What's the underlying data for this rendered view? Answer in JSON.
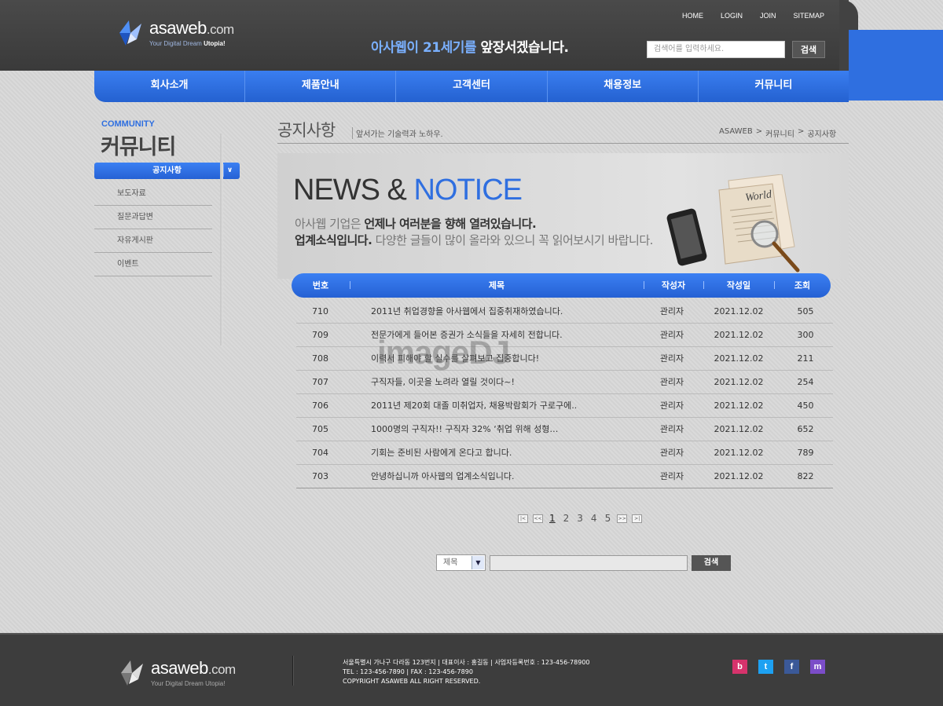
{
  "header": {
    "logo_name": "asaweb",
    "logo_com": ".com",
    "logo_sub_1": "Your Digital Dream",
    "logo_sub_2": "Utopia!",
    "util_links": [
      "HOME",
      "LOGIN",
      "JOIN",
      "SITEMAP"
    ],
    "slogan_hl": "아사웹이 21세기를",
    "slogan_rest": " 앞장서겠습니다.",
    "search_placeholder": "검색어를 입력하세요.",
    "search_button": "검색"
  },
  "nav": [
    "회사소개",
    "제품안내",
    "고객센터",
    "채용정보",
    "커뮤니티"
  ],
  "sidebar": {
    "title_en": "COMMUNITY",
    "title_ko": "커뮤니티",
    "active": "공지사항",
    "active_chevron": "∨",
    "items": [
      "보도자료",
      "질문과답변",
      "자유게시판",
      "이벤트"
    ]
  },
  "content": {
    "title": "공지사항",
    "subtitle": "앞서가는 기술력과 노하우.",
    "breadcrumb": [
      "ASAWEB",
      ">",
      "커뮤니티",
      ">",
      "공지사항"
    ],
    "banner_h_1": "NEWS & ",
    "banner_h_2": "NOTICE",
    "banner_l1_a": "아사웹 기업은 ",
    "banner_l1_b": "언제나 여러분을 향해 열려있습니다.",
    "banner_l2_a": "업계소식입니다.",
    "banner_l2_b": " 다양한 글들이 많이 올라와 있으니 꼭 읽어보시기 바랍니다.",
    "newspaper_word": "World"
  },
  "table": {
    "headers": [
      "번호",
      "제목",
      "작성자",
      "작성일",
      "조회"
    ],
    "rows": [
      {
        "no": "710",
        "title": "2011년 취업경향을 아사웹에서 집중취재하였습니다.",
        "author": "관리자",
        "date": "2021.12.02",
        "views": "505"
      },
      {
        "no": "709",
        "title": "전문가에게 들어본 증권가 소식들을 자세히 전합니다.",
        "author": "관리자",
        "date": "2021.12.02",
        "views": "300"
      },
      {
        "no": "708",
        "title": "이력서 피해야 할 실수를 살펴보고 집중합니다!",
        "author": "관리자",
        "date": "2021.12.02",
        "views": "211"
      },
      {
        "no": "707",
        "title": "구직자들, 이곳을 노려라 열릴 것이다~!",
        "author": "관리자",
        "date": "2021.12.02",
        "views": "254"
      },
      {
        "no": "706",
        "title": "2011년 제20회 대졸 미취업자, 채용박람회가 구로구에..",
        "author": "관리자",
        "date": "2021.12.02",
        "views": "450"
      },
      {
        "no": "705",
        "title": "1000명의 구직자!! 구직자 32% ‘취업 위해 성형…",
        "author": "관리자",
        "date": "2021.12.02",
        "views": "652"
      },
      {
        "no": "704",
        "title": "기회는 준비된 사람에게 온다고 합니다.",
        "author": "관리자",
        "date": "2021.12.02",
        "views": "789"
      },
      {
        "no": "703",
        "title": "안녕하십니까 아사웹의 업계소식입니다.",
        "author": "관리자",
        "date": "2021.12.02",
        "views": "822"
      }
    ]
  },
  "pagination": {
    "first": "|<",
    "prev": "<<",
    "pages": [
      "1",
      "2",
      "3",
      "4",
      "5"
    ],
    "current": "1",
    "next": ">>",
    "last": ">|"
  },
  "bottom_search": {
    "select_value": "제목",
    "select_arrow": "▼",
    "button": "검색"
  },
  "footer": {
    "line1": "서울특별시 가나구 다라동 123번지  |  대표이사 : 홍길동  |  사업자등록번호 : 123-456-78900",
    "line2": "TEL : 123-456-7890  |  FAX : 123-456-7890",
    "line3": "COPYRIGHT ASAWEB ALL RIGHT RESERVED.",
    "social": [
      {
        "name": "blog-icon",
        "glyph": "b",
        "color": "#d6336c"
      },
      {
        "name": "twitter-icon",
        "glyph": "t",
        "color": "#1da1f2"
      },
      {
        "name": "facebook-icon",
        "glyph": "f",
        "color": "#3b5998"
      },
      {
        "name": "me2day-icon",
        "glyph": "m",
        "color": "#7b4dc8"
      }
    ]
  },
  "watermark": "imageDJ",
  "colors": {
    "accent": "#2f6fe0",
    "dark": "#3d3d3d"
  }
}
